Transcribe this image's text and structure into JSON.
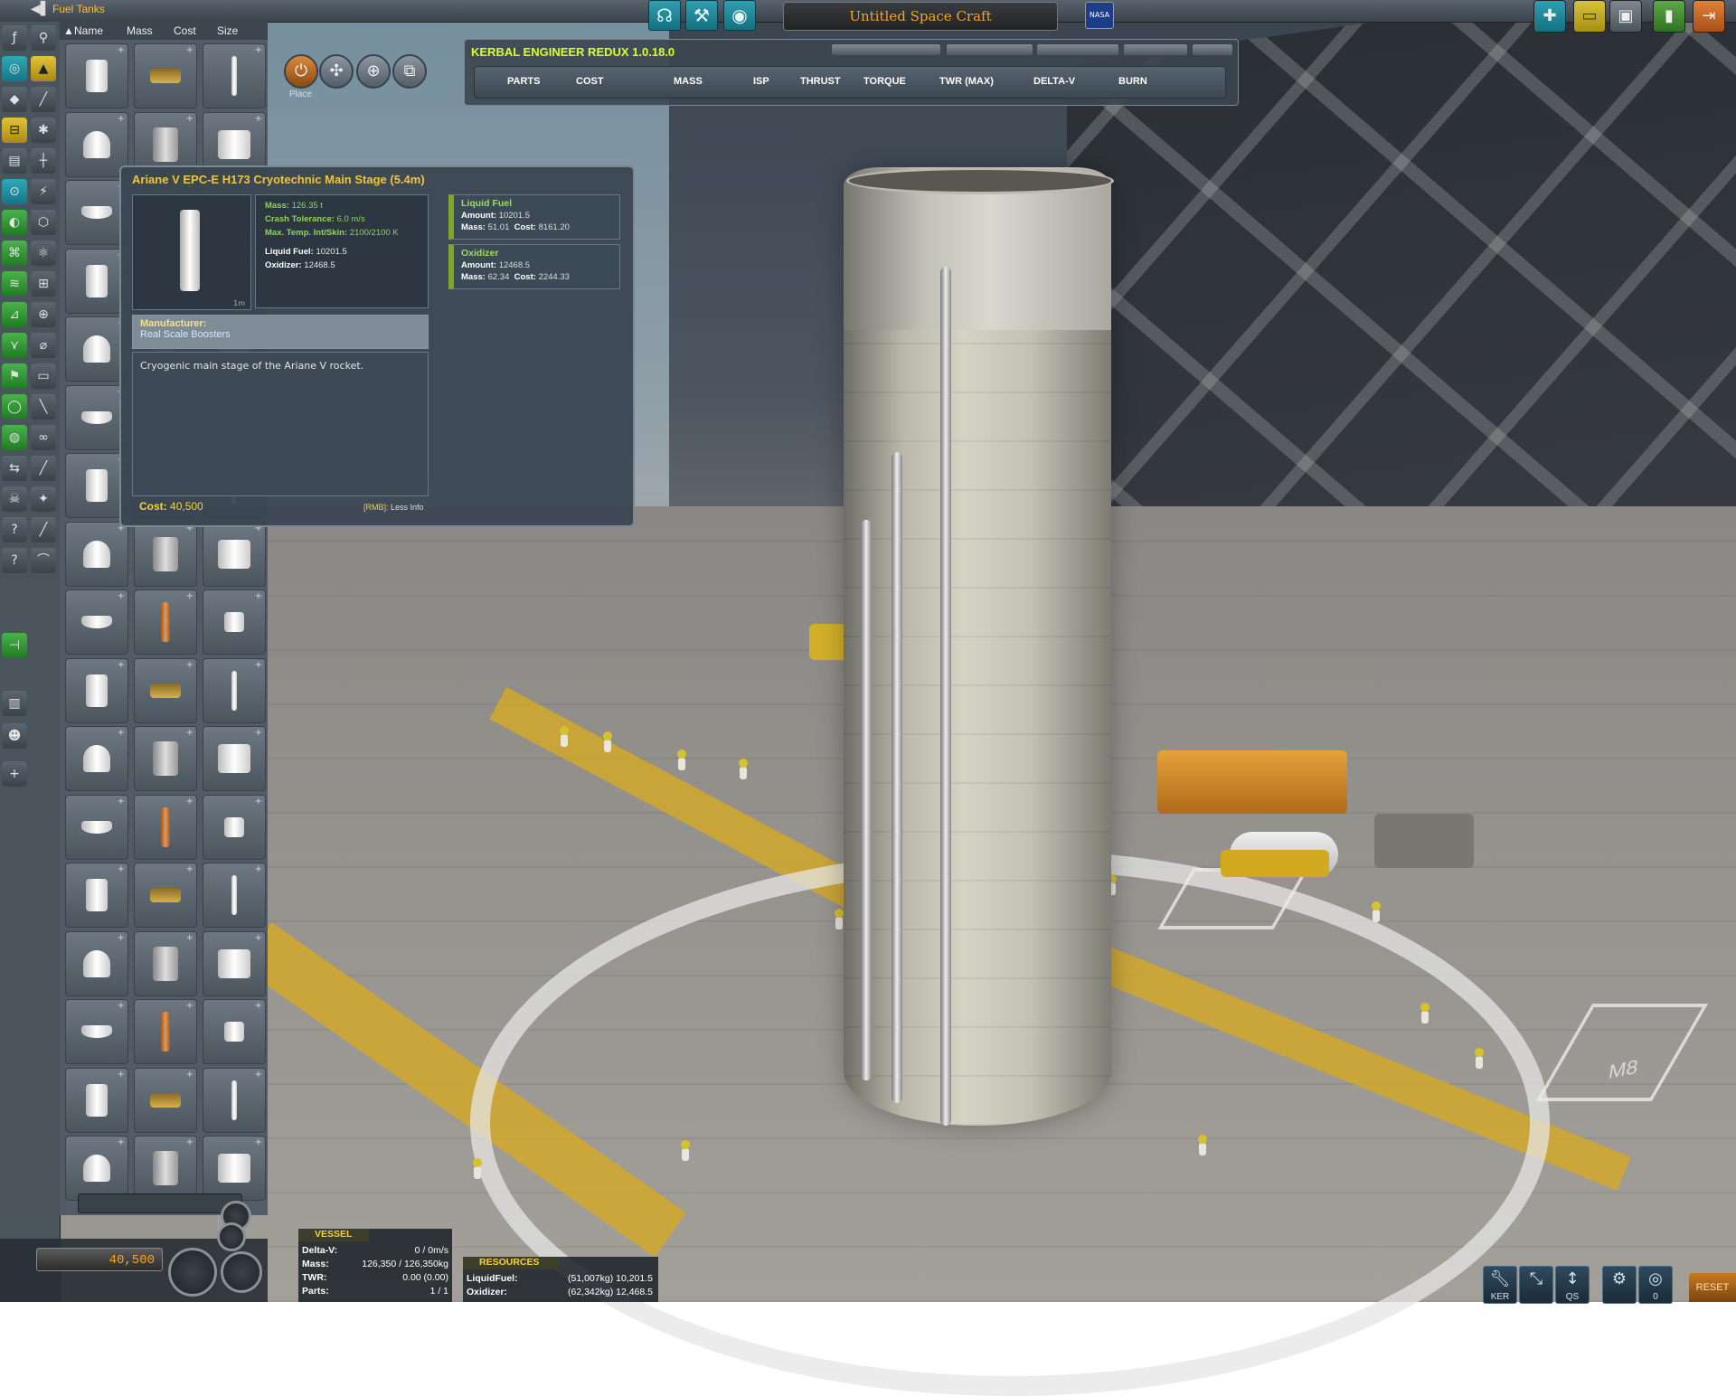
{
  "top_bar": {
    "category_title": "Fuel Tanks",
    "craft_name": "Untitled Space Craft",
    "flag": "NASA"
  },
  "parts_list": {
    "sort_columns": [
      "Name",
      "Mass",
      "Cost",
      "Size"
    ],
    "sort_active_indicator": "▲"
  },
  "editor_modes": {
    "current_label": "Place",
    "buttons": [
      "place-icon",
      "offset-icon",
      "rotate-icon",
      "root-icon"
    ]
  },
  "ker": {
    "title": "KERBAL ENGINEER REDUX 1.0.18.0",
    "columns": [
      "PARTS",
      "COST",
      "MASS",
      "ISP",
      "THRUST",
      "TORQUE",
      "TWR (MAX)",
      "DELTA-V",
      "BURN"
    ]
  },
  "tooltip": {
    "title": "Ariane V EPC-E H173 Cryotechnic Main Stage (5.4m)",
    "thumb_size_label": "1m",
    "stats": {
      "mass_label": "Mass:",
      "mass_value": "126.35 t",
      "crash_label": "Crash Tolerance:",
      "crash_value": "6.0 m/s",
      "temp_label": "Max. Temp. Int/Skin:",
      "temp_value": "2100/2100 K",
      "lf_label": "Liquid Fuel:",
      "lf_value": "10201.5",
      "ox_label": "Oxidizer:",
      "ox_value": "12468.5"
    },
    "resources": [
      {
        "name": "Liquid Fuel",
        "amount_label": "Amount:",
        "amount": "10201.5",
        "mass_label": "Mass:",
        "mass": "51.01",
        "cost_label": "Cost:",
        "cost": "8161.20"
      },
      {
        "name": "Oxidizer",
        "amount_label": "Amount:",
        "amount": "12468.5",
        "mass_label": "Mass:",
        "mass": "62.34",
        "cost_label": "Cost:",
        "cost": "2244.33"
      }
    ],
    "manufacturer_label": "Manufacturer:",
    "manufacturer": "Real Scale Boosters",
    "description": "Cryogenic main stage of the Ariane V rocket.",
    "cost_label": "Cost:",
    "cost_value": "40,500",
    "rmb_key": "[RMB]:",
    "rmb_text": "Less Info"
  },
  "budget": {
    "funds": "40,500"
  },
  "vessel": {
    "header": "VESSEL",
    "rows": [
      {
        "label": "Delta-V:",
        "value": "0 / 0m/s"
      },
      {
        "label": "Mass:",
        "value": "126,350 / 126,350kg"
      },
      {
        "label": "TWR:",
        "value": "0.00 (0.00)"
      },
      {
        "label": "Parts:",
        "value": "1 / 1"
      }
    ]
  },
  "resources_panel": {
    "header": "RESOURCES",
    "rows": [
      {
        "label": "LiquidFuel:",
        "value": "(51,007kg) 10,201.5"
      },
      {
        "label": "Oxidizer:",
        "value": "(62,342kg) 12,468.5"
      }
    ]
  },
  "bottom_right": {
    "ker_caption": "KER",
    "qs_caption": "QS",
    "sound_count": "0",
    "reset_label": "RESET"
  },
  "scene": {
    "pad_marking": "M8"
  },
  "colors": {
    "accent_yellow": "#f3c23a",
    "ker_title": "#d9ff2a",
    "stat_green": "#8fd35a",
    "toolbar_teal": "#2f9fb0"
  }
}
